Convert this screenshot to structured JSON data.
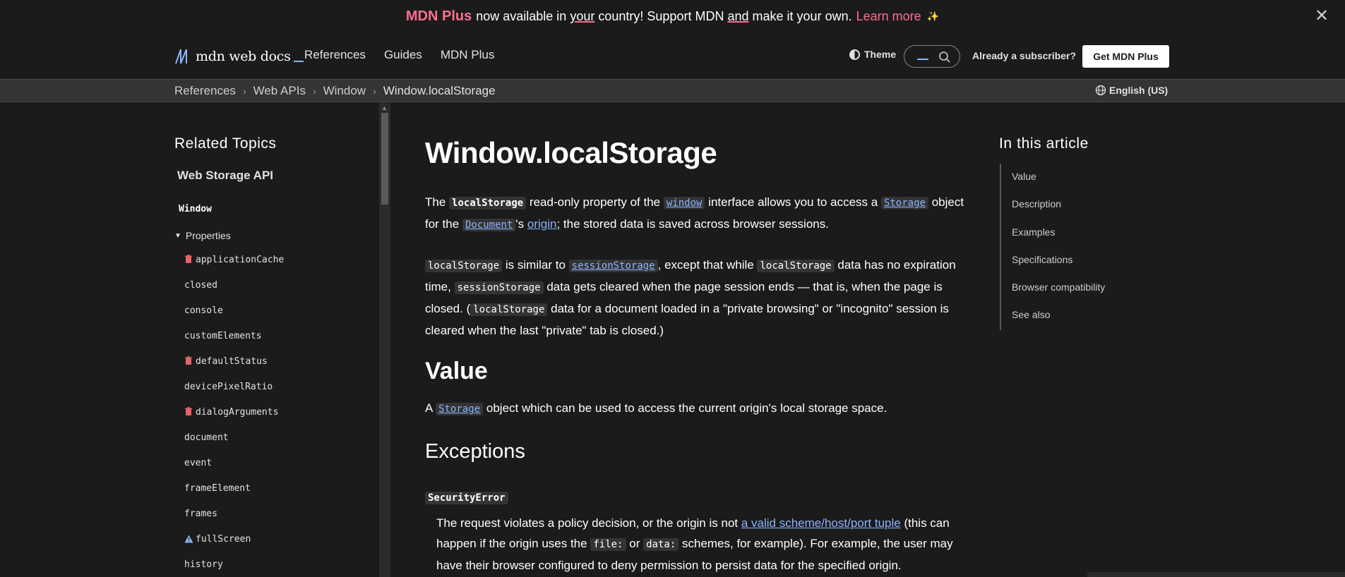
{
  "banner": {
    "brand": "MDN Plus",
    "text_1": "now available in",
    "text_your": "your",
    "text_2": "country! Support MDN",
    "text_and": "and",
    "text_3": "make it your own.",
    "learn_more": "Learn more",
    "sparkle": "✨",
    "close": "✕"
  },
  "header": {
    "logo_text": "mdn web docs",
    "nav": [
      "References",
      "Guides",
      "MDN Plus"
    ],
    "theme_label": "Theme",
    "already_subscriber": "Already a subscriber?",
    "get_plus": "Get MDN Plus"
  },
  "breadcrumb": {
    "items": [
      "References",
      "Web APIs",
      "Window",
      "Window.localStorage"
    ],
    "separator": "›",
    "language": "English (US)"
  },
  "sidebar": {
    "related_title": "Related Topics",
    "section_title": "Web Storage API",
    "window_label": "Window",
    "properties_label": "Properties",
    "items": [
      {
        "label": "applicationCache",
        "icon": "trash-icon"
      },
      {
        "label": "closed",
        "icon": ""
      },
      {
        "label": "console",
        "icon": ""
      },
      {
        "label": "customElements",
        "icon": ""
      },
      {
        "label": "defaultStatus",
        "icon": "trash-icon"
      },
      {
        "label": "devicePixelRatio",
        "icon": ""
      },
      {
        "label": "dialogArguments",
        "icon": "trash-icon"
      },
      {
        "label": "document",
        "icon": ""
      },
      {
        "label": "event",
        "icon": ""
      },
      {
        "label": "frameElement",
        "icon": ""
      },
      {
        "label": "frames",
        "icon": ""
      },
      {
        "label": "fullScreen",
        "icon": "warning-icon"
      },
      {
        "label": "history",
        "icon": ""
      }
    ],
    "colors": {
      "deprecated": "#e66465",
      "warning": "#8cb4ff"
    }
  },
  "main": {
    "title": "Window.localStorage",
    "intro": {
      "t1": "The",
      "c_localStorage": "localStorage",
      "t2": "read-only property of the",
      "l_window": "window",
      "t3": "interface allows you to access a",
      "l_storage": "Storage",
      "t4": "object for the",
      "l_document": "Document",
      "t5": "'s",
      "l_origin": "origin",
      "t6": "; the stored data is saved across browser sessions."
    },
    "para2": {
      "c1": "localStorage",
      "t1": "is similar to",
      "l_session": "sessionStorage",
      "t2": ", except that while",
      "c2": "localStorage",
      "t3": "data has no expiration time,",
      "c3": "sessionStorage",
      "t4": "data gets cleared when the page session ends — that is, when the page is closed. (",
      "c4": "localStorage",
      "t5": "data for a document loaded in a \"private browsing\" or \"incognito\" session is cleared when the last \"private\" tab is closed.)"
    },
    "value_heading": "Value",
    "value_text": {
      "t1": "A",
      "l_storage": "Storage",
      "t2": "object which can be used to access the current origin's local storage space."
    },
    "exceptions_heading": "Exceptions",
    "exception_name": "SecurityError",
    "exception_desc": {
      "t1": "The request violates a policy decision, or the origin is not",
      "l_tuple": "a valid scheme/host/port tuple",
      "t2": "(this can happen if the origin uses the",
      "c_file": "file:",
      "t3": "or",
      "c_data": "data:",
      "t4": "schemes, for example). For example, the user may have their browser configured to deny permission to persist data for the specified origin."
    }
  },
  "toc": {
    "title": "In this article",
    "items": [
      "Value",
      "Description",
      "Examples",
      "Specifications",
      "Browser compatibility",
      "See also"
    ]
  }
}
